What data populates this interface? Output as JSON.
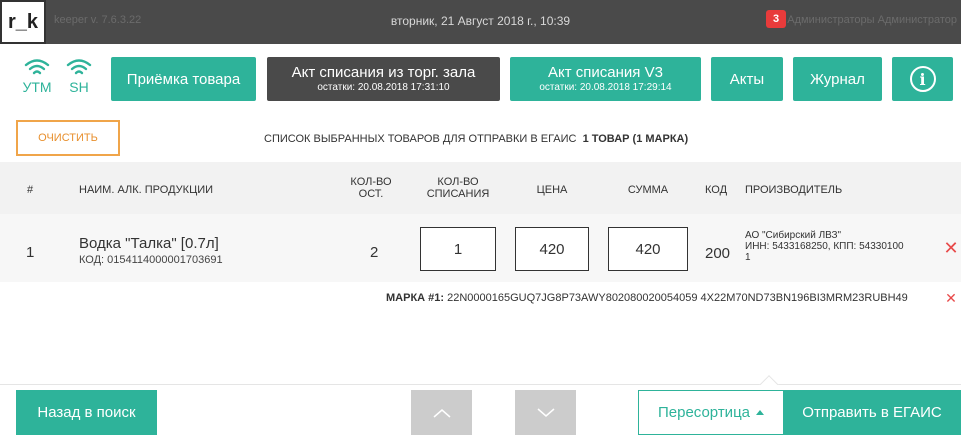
{
  "app": {
    "logo": "r_k",
    "version": "keeper v. 7.6.3.22",
    "datetime": "вторник, 21 Август 2018 г., 10:39",
    "user": "Администраторы Администратор"
  },
  "status": {
    "utm_label": "УТМ",
    "sh_label": "SH",
    "icon": "wifi-icon"
  },
  "toolbar": {
    "priemka": "Приёмка товара",
    "akt_torg": {
      "label": "Акт списания из торг. зала",
      "sub": "остатки: 20.08.2018 17:31:10"
    },
    "akt_v3": {
      "label": "Акт списания V3",
      "sub": "остатки: 20.08.2018 17:29:14"
    },
    "akty": "Акты",
    "akty_badge": "3",
    "journal": "Журнал",
    "info_icon": "i"
  },
  "list": {
    "clear_label": "ОЧИСТИТЬ",
    "title": "СПИСОК ВЫБРАННЫХ ТОВАРОВ ДЛЯ ОТПРАВКИ В ЕГАИС",
    "count": "1 ТОВАР  (1 МАРКА)"
  },
  "table": {
    "headers": {
      "num": "#",
      "name": "НАИМ. АЛК. ПРОДУКЦИИ",
      "ost_1": "КОЛ-ВО",
      "ost_2": "ОСТ.",
      "spis_1": "КОЛ-ВО",
      "spis_2": "СПИСАНИЯ",
      "price": "ЦЕНА",
      "sum": "СУММА",
      "kod": "КОД",
      "maker": "ПРОИЗВОДИТЕЛЬ"
    },
    "rows": [
      {
        "num": "1",
        "name": "Водка \"Талка\"  [0.7л]",
        "code": "КОД: 0154114000001703691",
        "ost": "2",
        "qty": "1",
        "price": "420",
        "sum": "420",
        "kod": "200",
        "maker_name": "АО \"Сибирский ЛВЗ\"",
        "maker_inn": "ИНН: 5433168250, КПП: 54330100",
        "maker_tail": "1"
      }
    ],
    "mark": {
      "prefix": "МАРКА #1:",
      "value": "22N0000165GUQ7JG8P73AWY802080020054059 4X22M70ND73BN196BI3MRM23RUBH49"
    }
  },
  "bottom": {
    "back": "Назад в поиск",
    "peresort": "Пересортица",
    "send": "Отправить в ЕГАИС"
  }
}
